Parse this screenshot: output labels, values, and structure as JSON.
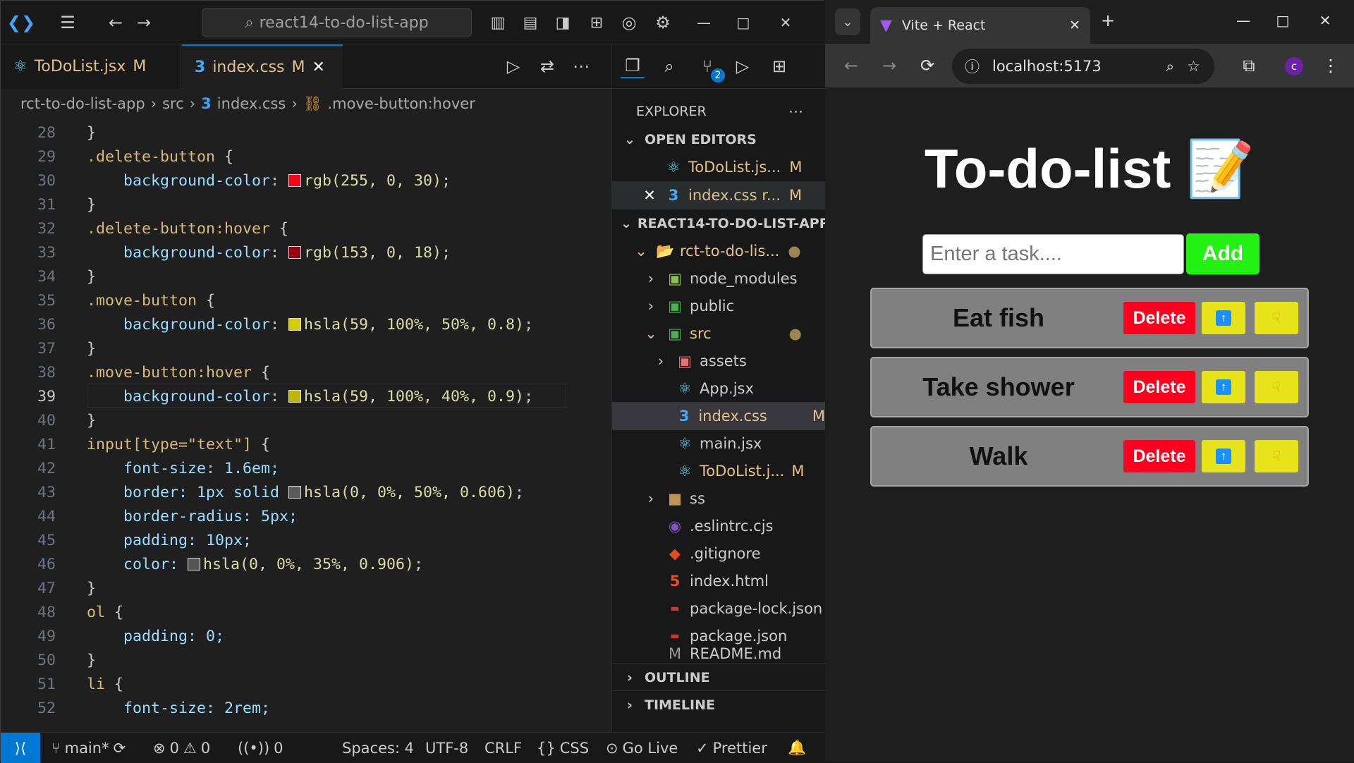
{
  "vscode": {
    "command_center": "react14-to-do-list-app",
    "tabs": [
      {
        "label": "ToDoList.jsx",
        "flag": "M"
      },
      {
        "label": "index.css",
        "flag": "M"
      }
    ],
    "breadcrumb": [
      "rct-to-do-list-app",
      "src",
      "index.css",
      ".move-button:hover"
    ],
    "code_lines": [
      {
        "n": "28"
      },
      {
        "n": "29"
      },
      {
        "n": "30"
      },
      {
        "n": "31"
      },
      {
        "n": "32"
      },
      {
        "n": "33"
      },
      {
        "n": "34"
      },
      {
        "n": "35"
      },
      {
        "n": "36"
      },
      {
        "n": "37"
      },
      {
        "n": "38"
      },
      {
        "n": "39"
      },
      {
        "n": "40"
      },
      {
        "n": "41"
      },
      {
        "n": "42"
      },
      {
        "n": "43"
      },
      {
        "n": "44"
      },
      {
        "n": "45"
      },
      {
        "n": "46"
      },
      {
        "n": "47"
      },
      {
        "n": "48"
      },
      {
        "n": "49"
      },
      {
        "n": "50"
      },
      {
        "n": "51"
      },
      {
        "n": "52"
      }
    ],
    "code": {
      "l28": "}",
      "l29_sel": ".delete-button",
      "l30_prop": "background-color",
      "l30_val": "rgb(255, 0, 30)",
      "l32_sel": ".delete-button:hover",
      "l33_val": "rgb(153, 0, 18)",
      "l35_sel": ".move-button",
      "l36_val": "hsla(59, 100%, 50%, 0.8)",
      "l38_sel": ".move-button:hover",
      "l39_val": "hsla(59, 100%, 40%, 0.9)",
      "l41_sel": "input[type=\"text\"]",
      "l42": "font-size: 1.6em;",
      "l43": "border: 1px solid ",
      "l43_val": "hsla(0, 0%, 50%, 0.606)",
      "l44": "border-radius: 5px;",
      "l45": "padding: 10px;",
      "l46": "color: ",
      "l46_val": "hsla(0, 0%, 35%, 0.906)",
      "l48_sel": "ol",
      "l49": "padding: 0;",
      "l51_sel": "li",
      "l52": "font-size: 2rem;"
    },
    "explorer": {
      "title": "EXPLORER",
      "open_editors": "OPEN EDITORS",
      "open_files": [
        {
          "label": "ToDoList.js...",
          "flag": "M"
        },
        {
          "label": "index.css r...",
          "flag": "M"
        }
      ],
      "project": "REACT14-TO-DO-LIST-APP",
      "tree": [
        {
          "label": "rct-to-do-lis..."
        },
        {
          "label": "node_modules"
        },
        {
          "label": "public"
        },
        {
          "label": "src"
        },
        {
          "label": "assets"
        },
        {
          "label": "App.jsx"
        },
        {
          "label": "index.css",
          "flag": "M"
        },
        {
          "label": "main.jsx"
        },
        {
          "label": "ToDoList.j...",
          "flag": "M"
        },
        {
          "label": "ss"
        },
        {
          "label": ".eslintrc.cjs"
        },
        {
          "label": ".gitignore"
        },
        {
          "label": "index.html"
        },
        {
          "label": "package-lock.json"
        },
        {
          "label": "package.json"
        },
        {
          "label": "README.md"
        }
      ],
      "outline": "OUTLINE",
      "timeline": "TIMELINE",
      "scm_badge": "2"
    },
    "status": {
      "branch": "main*",
      "errors": "0",
      "warnings": "0",
      "ports": "0",
      "spaces": "Spaces: 4",
      "encoding": "UTF-8",
      "eol": "CRLF",
      "language": "CSS",
      "golive": "Go Live",
      "prettier": "Prettier"
    }
  },
  "browser": {
    "tab_title": "Vite + React",
    "url": "localhost:5173",
    "profile": "c",
    "app": {
      "title": "To-do-list 📝",
      "input_placeholder": "Enter a task....",
      "add_label": "Add",
      "delete_label": "Delete",
      "tasks": [
        "Eat fish",
        "Take shower",
        "Walk"
      ]
    }
  }
}
